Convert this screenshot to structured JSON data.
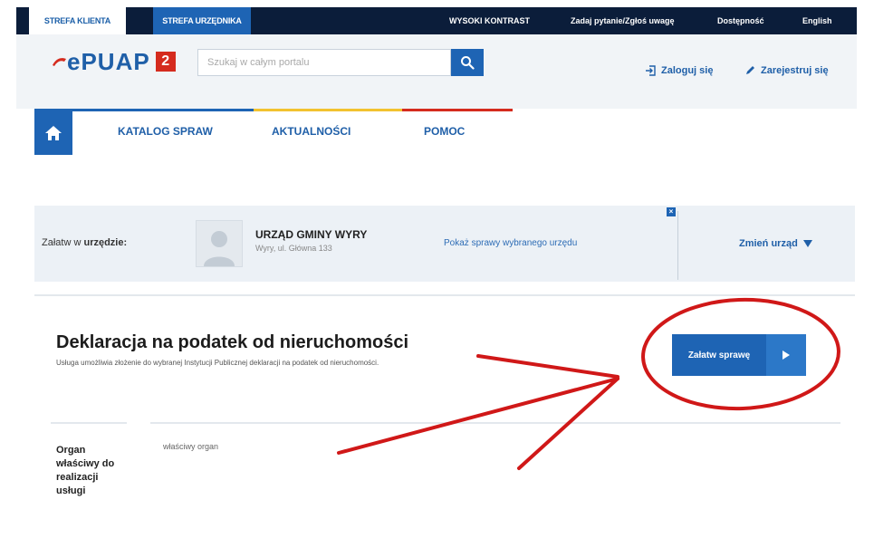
{
  "topbar": {
    "client_zone": "STREFA KLIENTA",
    "officer_zone": "STREFA URZĘDNIKA",
    "high_contrast": "WYSOKI KONTRAST",
    "ask_question": "Zadaj pytanie/Zgłoś uwagę",
    "accessibility": "Dostępność",
    "english": "English"
  },
  "header": {
    "logo_text": "ePUAP",
    "logo_badge": "2",
    "search_placeholder": "Szukaj w całym portalu",
    "login": "Zaloguj się",
    "register": "Zarejestruj się"
  },
  "nav": {
    "items": [
      "KATALOG SPRAW",
      "AKTUALNOŚCI",
      "POMOC"
    ],
    "colors": [
      "#1e64b4",
      "#f2c230",
      "#d52b1e"
    ]
  },
  "office": {
    "label_prefix": "Załatw w",
    "label_strong": "urzędzie:",
    "name": "URZĄD GMINY WYRY",
    "address": "Wyry, ul. Główna 133",
    "show_services": "Pokaż sprawy wybranego urzędu",
    "close": "×",
    "change": "Zmień urząd"
  },
  "service": {
    "title": "Deklaracja na podatek od nieruchomości",
    "description": "Usługa umożliwia złożenie do wybranej Instytucji Publicznej deklaracji na podatek od nieruchomości.",
    "start_button": "Załatw sprawę"
  },
  "details": {
    "label": "Organ właściwy do realizacji usługi",
    "value": "właściwy organ"
  },
  "colors": {
    "primary": "#1e64b4",
    "dark": "#0b1d3a",
    "annotation": "#d01818"
  }
}
